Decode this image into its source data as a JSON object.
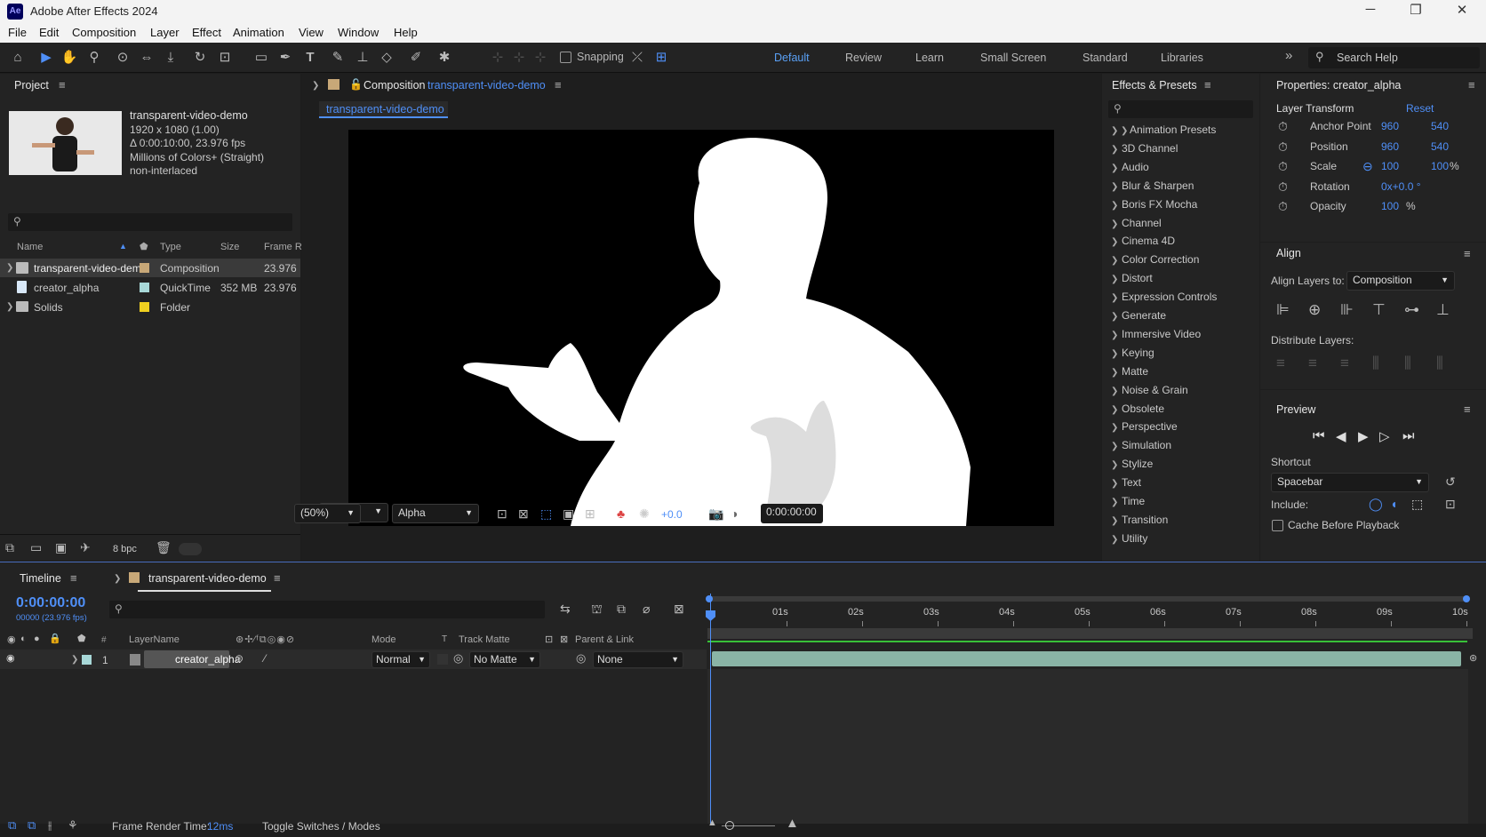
{
  "app": {
    "title": "Adobe After Effects 2024",
    "logo": "Ae"
  },
  "window_controls": [
    "─",
    "❐",
    "✕"
  ],
  "menu": [
    "File",
    "Edit",
    "Composition",
    "Layer",
    "Effect",
    "Animation",
    "View",
    "Window",
    "Help"
  ],
  "toolbar": {
    "snapping_label": "Snapping",
    "workspaces": [
      "Default",
      "Review",
      "Learn",
      "Small Screen",
      "Standard",
      "Libraries"
    ],
    "active_workspace": "Default",
    "search_placeholder": "Search Help",
    "more": "»"
  },
  "project": {
    "title": "Project",
    "item_name": "transparent-video-demo",
    "meta": [
      "1920 x 1080 (1.00)",
      "Δ 0:00:10:00, 23.976 fps",
      "Millions of Colors+ (Straight)",
      "non-interlaced"
    ],
    "columns": [
      "Name",
      "Type",
      "Size",
      "Frame R."
    ],
    "items": [
      {
        "name": "transparent-video-demo",
        "type": "Composition",
        "size": "",
        "rate": "23.976",
        "color": "#c8a878"
      },
      {
        "name": "creator_alpha",
        "type": "QuickTime",
        "size": "352 MB",
        "rate": "23.976",
        "color": "#a8d8d8"
      },
      {
        "name": "Solids",
        "type": "Folder",
        "size": "",
        "rate": "",
        "color": "#f0d020"
      }
    ],
    "bpc": "8 bpc"
  },
  "composition": {
    "header_label": "Composition",
    "name": "transparent-video-demo",
    "tab": "transparent-video-demo",
    "zoom": "(50%)",
    "channel": "Alpha",
    "exposure": "+0.0",
    "timecode": "0:00:00:00"
  },
  "effects": {
    "title": "Effects & Presets",
    "items": [
      "Animation Presets",
      "3D Channel",
      "Audio",
      "Blur & Sharpen",
      "Boris FX Mocha",
      "Channel",
      "Cinema 4D",
      "Color Correction",
      "Distort",
      "Expression Controls",
      "Generate",
      "Immersive Video",
      "Keying",
      "Matte",
      "Noise & Grain",
      "Obsolete",
      "Perspective",
      "Simulation",
      "Stylize",
      "Text",
      "Time",
      "Transition",
      "Utility"
    ]
  },
  "properties": {
    "title": "Properties: creator_alpha",
    "section": "Layer Transform",
    "reset": "Reset",
    "rows": [
      {
        "label": "Anchor Point",
        "v1": "960",
        "v2": "540",
        "unit": ""
      },
      {
        "label": "Position",
        "v1": "960",
        "v2": "540",
        "unit": ""
      },
      {
        "label": "Scale",
        "v1": "100",
        "v2": "100",
        "unit": "%"
      },
      {
        "label": "Rotation",
        "v1": "0x+0.0 °",
        "v2": "",
        "unit": ""
      },
      {
        "label": "Opacity",
        "v1": "100",
        "v2": "",
        "unit": "%"
      }
    ]
  },
  "align": {
    "title": "Align",
    "align_to_label": "Align Layers to:",
    "align_to_value": "Composition",
    "distribute_label": "Distribute Layers:"
  },
  "preview": {
    "title": "Preview",
    "shortcut_label": "Shortcut",
    "shortcut_value": "Spacebar",
    "include_label": "Include:",
    "cache_label": "Cache Before Playback"
  },
  "timeline": {
    "title": "Timeline",
    "comp_tab": "transparent-video-demo",
    "timecode": "0:00:00:00",
    "frames": "00000 (23.976 fps)",
    "columns": {
      "num": "#",
      "layer_name": "LayerName",
      "mode": "Mode",
      "t": "T",
      "track_matte": "Track Matte",
      "parent": "Parent & Link"
    },
    "layer": {
      "num": "1",
      "name": "creator_alpha",
      "mode": "Normal",
      "matte": "No Matte",
      "parent": "None"
    },
    "ruler": [
      "01s",
      "02s",
      "03s",
      "04s",
      "05s",
      "06s",
      "07s",
      "08s",
      "09s",
      "10s"
    ],
    "render_label": "Frame Render Time:",
    "render_value": "12ms",
    "toggle_label": "Toggle Switches / Modes"
  }
}
